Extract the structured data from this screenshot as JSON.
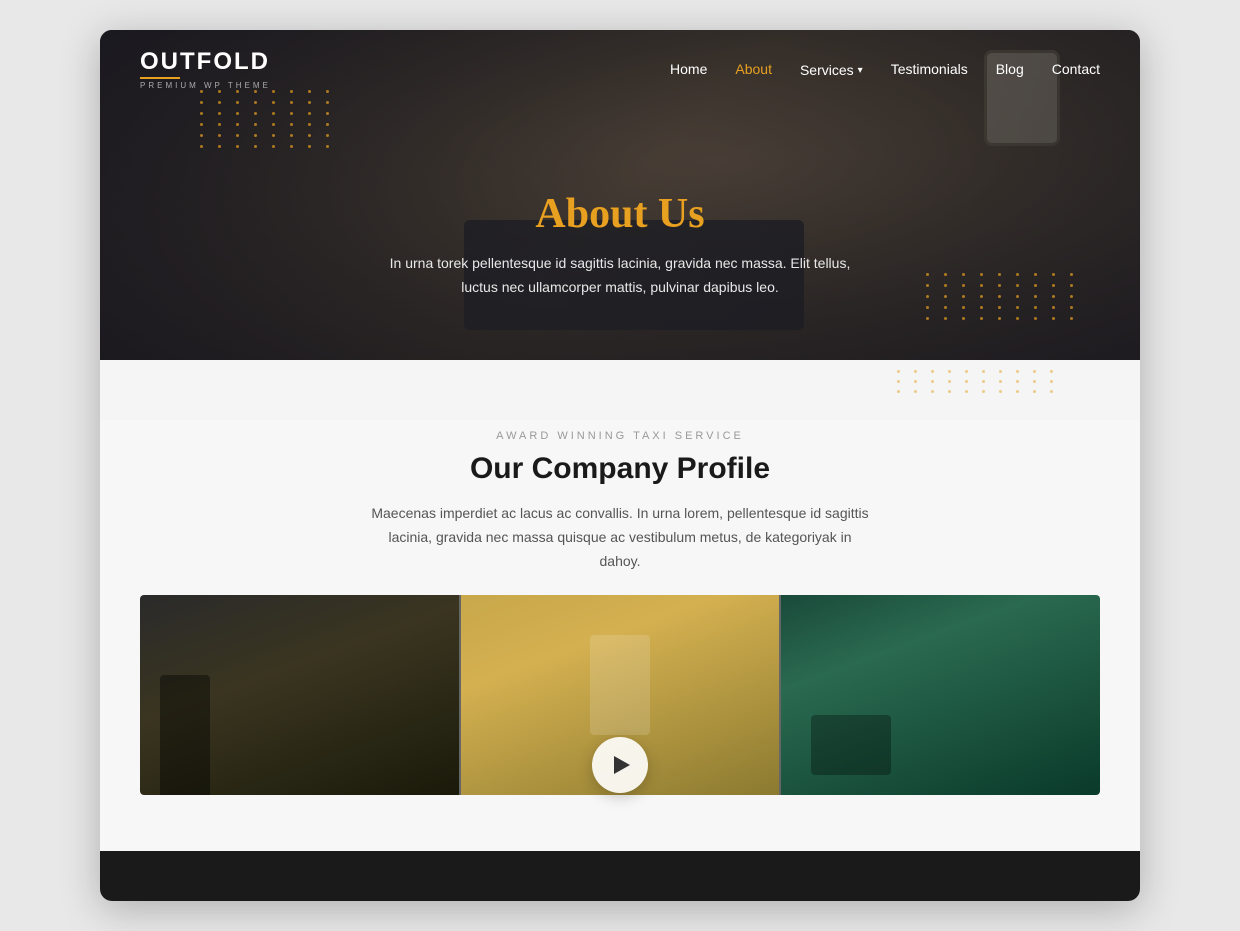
{
  "logo": {
    "name": "OUTFOLD",
    "tagline": "PREMIUM WP THEME",
    "underline_color": "#e8a020"
  },
  "nav": {
    "items": [
      {
        "label": "Home",
        "active": false
      },
      {
        "label": "About",
        "active": true
      },
      {
        "label": "Services",
        "active": false,
        "has_dropdown": true
      },
      {
        "label": "Testimonials",
        "active": false
      },
      {
        "label": "Blog",
        "active": false
      },
      {
        "label": "Contact",
        "active": false
      }
    ]
  },
  "hero": {
    "title": "About Us",
    "description": "In urna torek pellentesque id sagittis lacinia, gravida nec massa. Elit tellus, luctus nec ullamcorper mattis, pulvinar dapibus leo."
  },
  "company_section": {
    "tag": "AWARD WINNING TAXI SERVICE",
    "title": "Our Company Profile",
    "description": "Maecenas imperdiet ac lacus ac convallis. In urna lorem, pellentesque id sagittis lacinia, gravida nec massa quisque ac vestibulum metus, de kategoriyak in dahoy."
  }
}
